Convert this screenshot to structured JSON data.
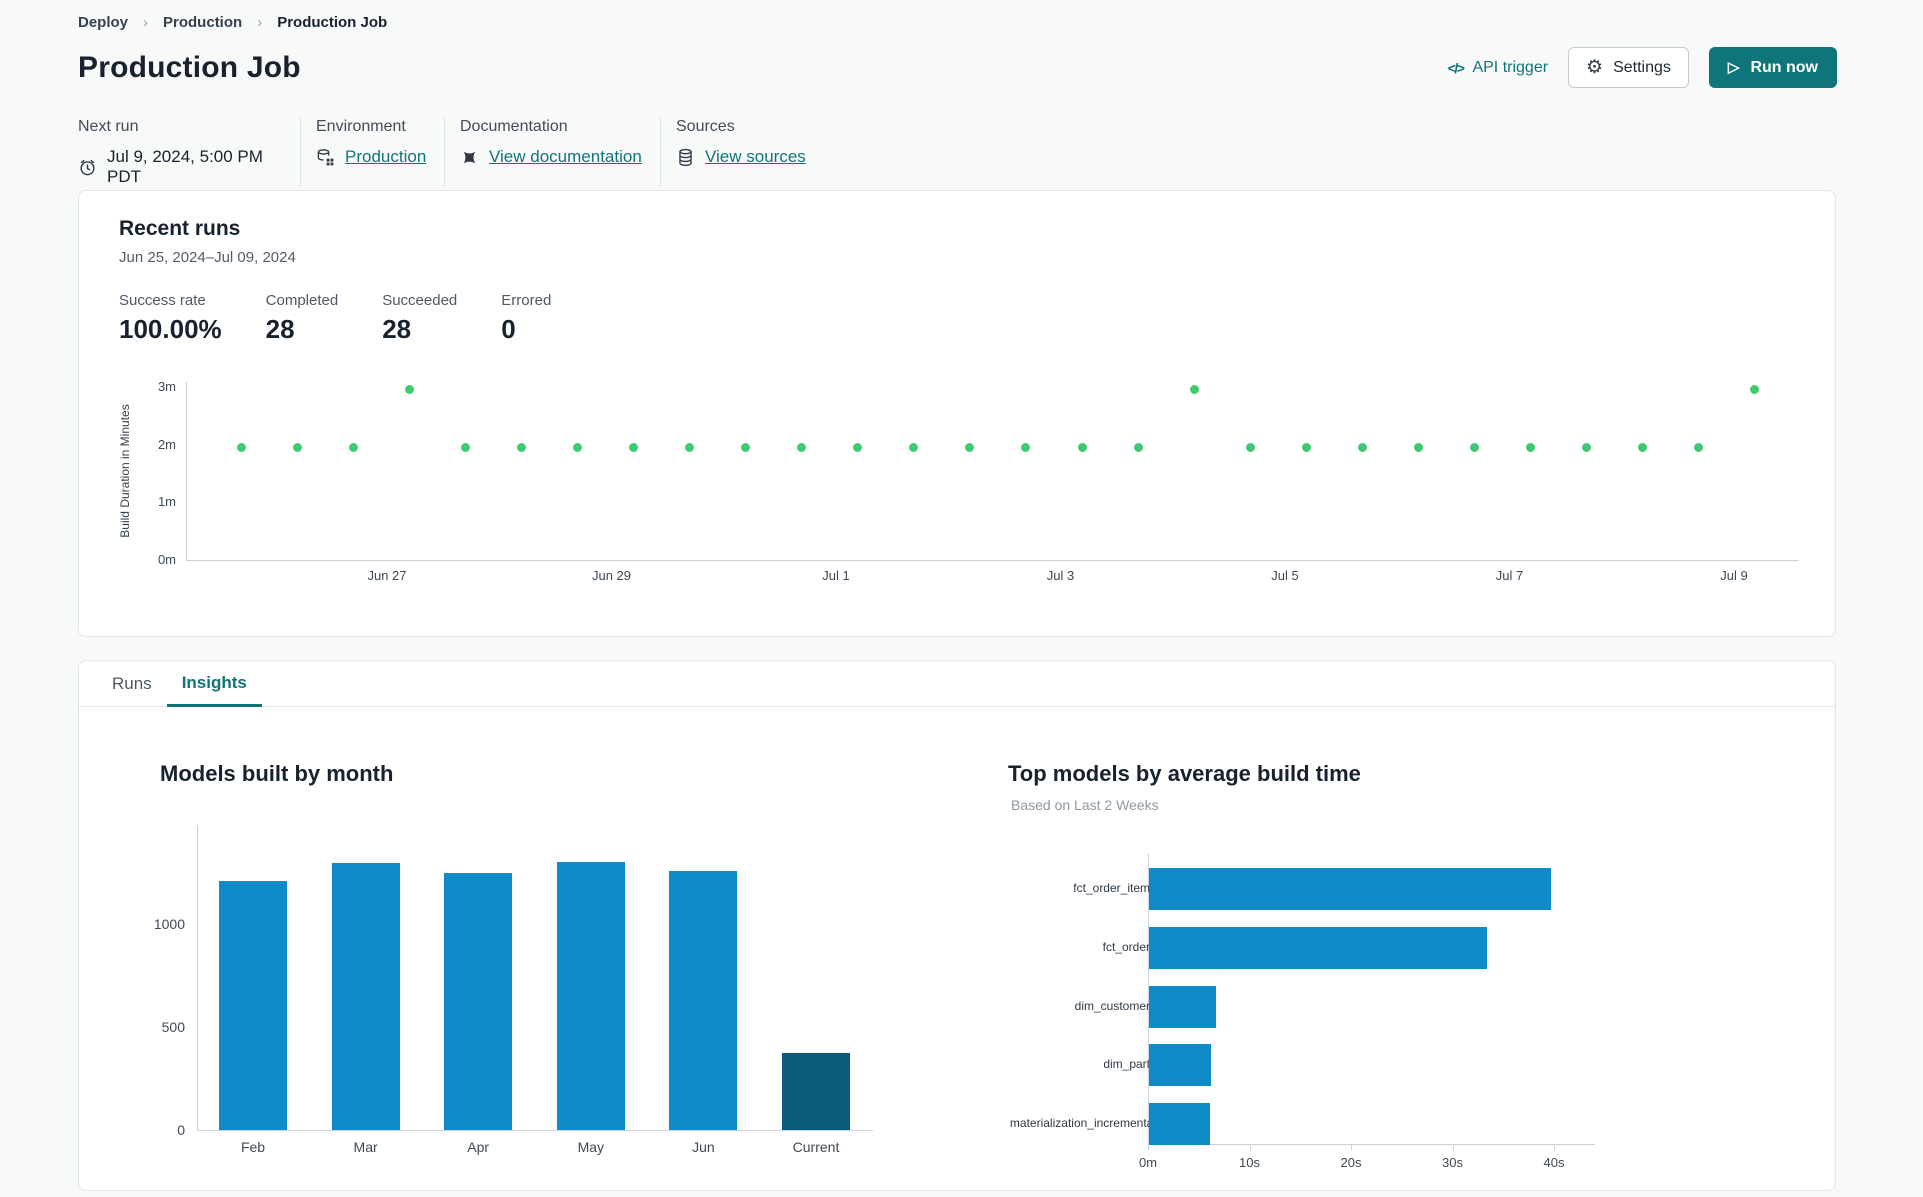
{
  "breadcrumb": {
    "items": [
      "Deploy",
      "Production",
      "Production Job"
    ],
    "separator": "›"
  },
  "header": {
    "title": "Production Job",
    "api_trigger_icon": "</>",
    "api_trigger_label": "API trigger",
    "settings_label": "Settings",
    "run_now_label": "Run now"
  },
  "icons": {
    "gear": "⚙",
    "play": "▷"
  },
  "info": {
    "next_run": {
      "label": "Next run",
      "value": "Jul 9, 2024, 5:00 PM PDT"
    },
    "environment": {
      "label": "Environment",
      "value": "Production"
    },
    "documentation": {
      "label": "Documentation",
      "value": "View documentation"
    },
    "sources": {
      "label": "Sources",
      "value": "View sources"
    }
  },
  "recent_runs": {
    "title": "Recent runs",
    "date_range": "Jun 25, 2024–Jul 09, 2024",
    "stats": [
      {
        "label": "Success rate",
        "value": "100.00%"
      },
      {
        "label": "Completed",
        "value": "28"
      },
      {
        "label": "Succeeded",
        "value": "28"
      },
      {
        "label": "Errored",
        "value": "0"
      }
    ],
    "chart_data": {
      "type": "scatter",
      "ylabel": "Build Duration in Minutes",
      "y_tick_labels": [
        "3m",
        "2m",
        "1m",
        "0m"
      ],
      "x_tick_labels": [
        "Jun 27",
        "Jun 29",
        "Jul 1",
        "Jul 3",
        "Jul 5",
        "Jul 7",
        "Jul 9"
      ],
      "ylim_minutes": [
        0,
        3.6
      ],
      "points_minutes": [
        1.95,
        1.95,
        1.95,
        2.95,
        1.95,
        1.95,
        1.95,
        1.95,
        1.95,
        1.95,
        1.95,
        1.95,
        1.95,
        1.95,
        1.95,
        1.95,
        1.95,
        2.95,
        1.95,
        1.95,
        1.95,
        1.95,
        1.95,
        1.95,
        1.95,
        1.95,
        1.95,
        2.95
      ],
      "point_color": "#3ecb70"
    }
  },
  "tabs": [
    {
      "label": "Runs",
      "active": false
    },
    {
      "label": "Insights",
      "active": true
    }
  ],
  "insights": {
    "models_by_month": {
      "title": "Models built by month",
      "chart_data": {
        "type": "bar",
        "categories": [
          "Feb",
          "Mar",
          "Apr",
          "May",
          "Jun",
          "Current"
        ],
        "values": [
          1210,
          1295,
          1250,
          1300,
          1255,
          375
        ],
        "y_ticks": [
          0,
          500,
          1000
        ],
        "ylim": [
          0,
          1440
        ],
        "bar_color": "#0f8bc7",
        "highlight_color": "#0c5a7c",
        "highlight_index": 5
      }
    },
    "top_models": {
      "title": "Top models by average build time",
      "subtitle": "Based on Last 2 Weeks",
      "chart_data": {
        "type": "bar-horizontal",
        "categories": [
          "fct_order_items",
          "fct_orders",
          "dim_customers",
          "dim_parts",
          "materialization_incremental"
        ],
        "values_seconds": [
          39.6,
          33.3,
          6.6,
          6.1,
          6.0
        ],
        "x_tick_labels": [
          "0m",
          "10s",
          "20s",
          "30s",
          "40s"
        ],
        "xlim_seconds": [
          0,
          44
        ],
        "bar_color": "#0f8bc7"
      }
    }
  },
  "colors": {
    "accent_teal": "#0f757b",
    "scatter_green": "#3ecb70",
    "bar_blue": "#0f8bc7",
    "bar_dark_blue": "#0c5a7c",
    "axis_line": "#ccd2d6"
  }
}
